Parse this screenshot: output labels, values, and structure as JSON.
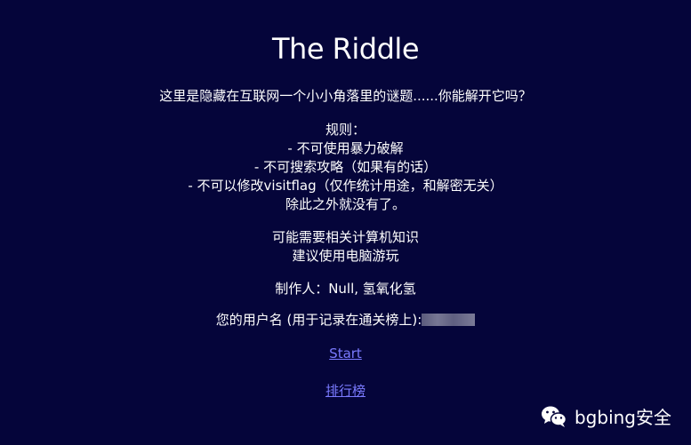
{
  "page": {
    "title": "The Riddle",
    "intro": "这里是隐藏在互联网一个小小角落里的谜题......你能解开它吗？",
    "rules": {
      "heading": "规则：",
      "items": [
        "- 不可使用暴力破解",
        "- 不可搜索攻略（如果有的话）",
        "- 不可以修改visitflag（仅作统计用途，和解密无关）"
      ],
      "footer": "除此之外就没有了。"
    },
    "hints": [
      "可能需要相关计算机知识",
      "建议使用电脑游玩"
    ],
    "author": "制作人：Null, 氢氧化氢",
    "username_label": "您的用户名 (用于记录在通关榜上):",
    "links": {
      "start": "Start",
      "ranking": "排行榜"
    }
  },
  "watermark": {
    "icon": "wechat-icon",
    "text": "bgbing安全"
  },
  "colors": {
    "background": "#05053a",
    "text": "#ffffff",
    "link": "#7a7aff"
  }
}
